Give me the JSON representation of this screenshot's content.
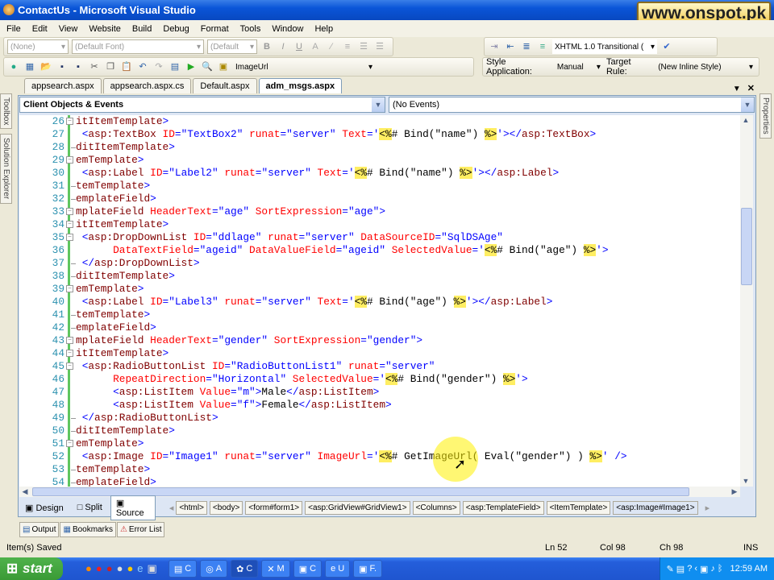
{
  "window": {
    "title": "ContactUs - Microsoft Visual Studio",
    "watermark": "www.onspot.pk"
  },
  "menu": [
    "File",
    "Edit",
    "View",
    "Website",
    "Build",
    "Debug",
    "Format",
    "Tools",
    "Window",
    "Help"
  ],
  "toolbar": {
    "block_format": "(None)",
    "font": "(Default Font)",
    "size": "(Default",
    "bold": "B",
    "italic": "I",
    "underline": "U",
    "doctype": "XHTML 1.0 Transitional (",
    "find_value": "ImageUrl",
    "style_application_label": "Style Application:",
    "style_application_value": "Manual",
    "target_rule_label": "Target Rule:",
    "target_rule_value": "(New Inline Style)"
  },
  "tabs": [
    {
      "label": "appsearch.aspx"
    },
    {
      "label": "appsearch.aspx.cs"
    },
    {
      "label": "Default.aspx"
    },
    {
      "label": "adm_msgs.aspx",
      "active": true
    }
  ],
  "side": {
    "toolbox": "Toolbox",
    "solution_explorer": "Solution Explorer",
    "properties": "Properties"
  },
  "dropdowns": {
    "objects": "Client Objects & Events",
    "events": "(No Events)"
  },
  "code": {
    "lines": [
      {
        "n": "26",
        "fold": "open",
        "segs": [
          [
            "t",
            "itItemTemplate"
          ],
          [
            "b",
            ">"
          ]
        ]
      },
      {
        "n": "27",
        "fold": "",
        "segs": [
          [
            "x",
            " "
          ],
          [
            "b",
            "<"
          ],
          [
            "t",
            "asp:TextBox"
          ],
          [
            "a",
            " ID"
          ],
          [
            "b",
            "="
          ],
          [
            "v",
            "\"TextBox2\""
          ],
          [
            "a",
            " runat"
          ],
          [
            "b",
            "="
          ],
          [
            "v",
            "\"server\""
          ],
          [
            "a",
            " Text"
          ],
          [
            "b",
            "="
          ],
          [
            "v",
            "'"
          ],
          [
            "h",
            "<%"
          ],
          [
            "x",
            "# Bind(\"name\") "
          ],
          [
            "h",
            "%>"
          ],
          [
            "v",
            "'"
          ],
          [
            "b",
            "></"
          ],
          [
            "t",
            "asp:TextBox"
          ],
          [
            "b",
            ">"
          ]
        ]
      },
      {
        "n": "28",
        "fold": "end",
        "segs": [
          [
            "t",
            "ditItemTemplate"
          ],
          [
            "b",
            ">"
          ]
        ]
      },
      {
        "n": "29",
        "fold": "open",
        "segs": [
          [
            "t",
            "emTemplate"
          ],
          [
            "b",
            ">"
          ]
        ]
      },
      {
        "n": "30",
        "fold": "",
        "segs": [
          [
            "x",
            " "
          ],
          [
            "b",
            "<"
          ],
          [
            "t",
            "asp:Label"
          ],
          [
            "a",
            " ID"
          ],
          [
            "b",
            "="
          ],
          [
            "v",
            "\"Label2\""
          ],
          [
            "a",
            " runat"
          ],
          [
            "b",
            "="
          ],
          [
            "v",
            "\"server\""
          ],
          [
            "a",
            " Text"
          ],
          [
            "b",
            "="
          ],
          [
            "v",
            "'"
          ],
          [
            "h",
            "<%"
          ],
          [
            "x",
            "# Bind(\"name\") "
          ],
          [
            "h",
            "%>"
          ],
          [
            "v",
            "'"
          ],
          [
            "b",
            "></"
          ],
          [
            "t",
            "asp:Label"
          ],
          [
            "b",
            ">"
          ]
        ]
      },
      {
        "n": "31",
        "fold": "end",
        "segs": [
          [
            "t",
            "temTemplate"
          ],
          [
            "b",
            ">"
          ]
        ]
      },
      {
        "n": "32",
        "fold": "end",
        "segs": [
          [
            "t",
            "emplateField"
          ],
          [
            "b",
            ">"
          ]
        ]
      },
      {
        "n": "33",
        "fold": "open",
        "segs": [
          [
            "t",
            "mplateField"
          ],
          [
            "a",
            " HeaderText"
          ],
          [
            "b",
            "="
          ],
          [
            "v",
            "\"age\""
          ],
          [
            "a",
            " SortExpression"
          ],
          [
            "b",
            "="
          ],
          [
            "v",
            "\"age\""
          ],
          [
            "b",
            ">"
          ]
        ]
      },
      {
        "n": "34",
        "fold": "open",
        "segs": [
          [
            "t",
            "itItemTemplate"
          ],
          [
            "b",
            ">"
          ]
        ]
      },
      {
        "n": "35",
        "fold": "open",
        "segs": [
          [
            "x",
            " "
          ],
          [
            "b",
            "<"
          ],
          [
            "t",
            "asp:DropDownList"
          ],
          [
            "a",
            " ID"
          ],
          [
            "b",
            "="
          ],
          [
            "v",
            "\"ddlage\""
          ],
          [
            "a",
            " runat"
          ],
          [
            "b",
            "="
          ],
          [
            "v",
            "\"server\""
          ],
          [
            "a",
            " DataSourceID"
          ],
          [
            "b",
            "="
          ],
          [
            "v",
            "\"SqlDSAge\""
          ]
        ]
      },
      {
        "n": "36",
        "fold": "",
        "segs": [
          [
            "x",
            "     "
          ],
          [
            "a",
            " DataTextField"
          ],
          [
            "b",
            "="
          ],
          [
            "v",
            "\"ageid\""
          ],
          [
            "a",
            " DataValueField"
          ],
          [
            "b",
            "="
          ],
          [
            "v",
            "\"ageid\""
          ],
          [
            "a",
            " SelectedValue"
          ],
          [
            "b",
            "="
          ],
          [
            "v",
            "'"
          ],
          [
            "h",
            "<%"
          ],
          [
            "x",
            "# Bind(\"age\") "
          ],
          [
            "h",
            "%>"
          ],
          [
            "v",
            "'"
          ],
          [
            "b",
            ">"
          ]
        ]
      },
      {
        "n": "37",
        "fold": "end",
        "segs": [
          [
            "x",
            " "
          ],
          [
            "b",
            "</"
          ],
          [
            "t",
            "asp:DropDownList"
          ],
          [
            "b",
            ">"
          ]
        ]
      },
      {
        "n": "38",
        "fold": "end",
        "segs": [
          [
            "t",
            "ditItemTemplate"
          ],
          [
            "b",
            ">"
          ]
        ]
      },
      {
        "n": "39",
        "fold": "open",
        "segs": [
          [
            "t",
            "emTemplate"
          ],
          [
            "b",
            ">"
          ]
        ]
      },
      {
        "n": "40",
        "fold": "",
        "segs": [
          [
            "x",
            " "
          ],
          [
            "b",
            "<"
          ],
          [
            "t",
            "asp:Label"
          ],
          [
            "a",
            " ID"
          ],
          [
            "b",
            "="
          ],
          [
            "v",
            "\"Label3\""
          ],
          [
            "a",
            " runat"
          ],
          [
            "b",
            "="
          ],
          [
            "v",
            "\"server\""
          ],
          [
            "a",
            " Text"
          ],
          [
            "b",
            "="
          ],
          [
            "v",
            "'"
          ],
          [
            "h",
            "<%"
          ],
          [
            "x",
            "# Bind(\"age\") "
          ],
          [
            "h",
            "%>"
          ],
          [
            "v",
            "'"
          ],
          [
            "b",
            "></"
          ],
          [
            "t",
            "asp:Label"
          ],
          [
            "b",
            ">"
          ]
        ]
      },
      {
        "n": "41",
        "fold": "end",
        "segs": [
          [
            "t",
            "temTemplate"
          ],
          [
            "b",
            ">"
          ]
        ]
      },
      {
        "n": "42",
        "fold": "end",
        "segs": [
          [
            "t",
            "emplateField"
          ],
          [
            "b",
            ">"
          ]
        ]
      },
      {
        "n": "43",
        "fold": "open",
        "segs": [
          [
            "t",
            "mplateField"
          ],
          [
            "a",
            " HeaderText"
          ],
          [
            "b",
            "="
          ],
          [
            "v",
            "\"gender\""
          ],
          [
            "a",
            " SortExpression"
          ],
          [
            "b",
            "="
          ],
          [
            "v",
            "\"gender\""
          ],
          [
            "b",
            ">"
          ]
        ]
      },
      {
        "n": "44",
        "fold": "open",
        "segs": [
          [
            "t",
            "itItemTemplate"
          ],
          [
            "b",
            ">"
          ]
        ]
      },
      {
        "n": "45",
        "fold": "open",
        "segs": [
          [
            "x",
            " "
          ],
          [
            "b",
            "<"
          ],
          [
            "t",
            "asp:RadioButtonList"
          ],
          [
            "a",
            " ID"
          ],
          [
            "b",
            "="
          ],
          [
            "v",
            "\"RadioButtonList1\""
          ],
          [
            "a",
            " runat"
          ],
          [
            "b",
            "="
          ],
          [
            "v",
            "\"server\""
          ]
        ]
      },
      {
        "n": "46",
        "fold": "",
        "segs": [
          [
            "x",
            "     "
          ],
          [
            "a",
            " RepeatDirection"
          ],
          [
            "b",
            "="
          ],
          [
            "v",
            "\"Horizontal\""
          ],
          [
            "a",
            " SelectedValue"
          ],
          [
            "b",
            "="
          ],
          [
            "v",
            "'"
          ],
          [
            "h",
            "<%"
          ],
          [
            "x",
            "# Bind(\"gender\") "
          ],
          [
            "h",
            "%>"
          ],
          [
            "v",
            "'"
          ],
          [
            "b",
            ">"
          ]
        ]
      },
      {
        "n": "47",
        "fold": "",
        "segs": [
          [
            "x",
            "     "
          ],
          [
            "b",
            " <"
          ],
          [
            "t",
            "asp:ListItem"
          ],
          [
            "a",
            " Value"
          ],
          [
            "b",
            "="
          ],
          [
            "v",
            "\"m\""
          ],
          [
            "b",
            ">"
          ],
          [
            "x",
            "Male"
          ],
          [
            "b",
            "</"
          ],
          [
            "t",
            "asp:ListItem"
          ],
          [
            "b",
            ">"
          ]
        ]
      },
      {
        "n": "48",
        "fold": "",
        "segs": [
          [
            "x",
            "     "
          ],
          [
            "b",
            " <"
          ],
          [
            "t",
            "asp:ListItem"
          ],
          [
            "a",
            " Value"
          ],
          [
            "b",
            "="
          ],
          [
            "v",
            "\"f\""
          ],
          [
            "b",
            ">"
          ],
          [
            "x",
            "Female"
          ],
          [
            "b",
            "</"
          ],
          [
            "t",
            "asp:ListItem"
          ],
          [
            "b",
            ">"
          ]
        ]
      },
      {
        "n": "49",
        "fold": "end",
        "segs": [
          [
            "x",
            " "
          ],
          [
            "b",
            "</"
          ],
          [
            "t",
            "asp:RadioButtonList"
          ],
          [
            "b",
            ">"
          ]
        ]
      },
      {
        "n": "50",
        "fold": "end",
        "segs": [
          [
            "t",
            "ditItemTemplate"
          ],
          [
            "b",
            ">"
          ]
        ]
      },
      {
        "n": "51",
        "fold": "open",
        "segs": [
          [
            "t",
            "emTemplate"
          ],
          [
            "b",
            ">"
          ]
        ]
      },
      {
        "n": "52",
        "fold": "",
        "segs": [
          [
            "x",
            " "
          ],
          [
            "b",
            "<"
          ],
          [
            "t",
            "asp:Image"
          ],
          [
            "a",
            " ID"
          ],
          [
            "b",
            "="
          ],
          [
            "v",
            "\"Image1\""
          ],
          [
            "a",
            " runat"
          ],
          [
            "b",
            "="
          ],
          [
            "v",
            "\"server\""
          ],
          [
            "a",
            " ImageUrl"
          ],
          [
            "b",
            "="
          ],
          [
            "v",
            "'"
          ],
          [
            "h",
            "<%"
          ],
          [
            "x",
            "# GetImageUrl( Eval(\"gender\") ) "
          ],
          [
            "h",
            "%>"
          ],
          [
            "v",
            "'"
          ],
          [
            "b",
            " />"
          ]
        ]
      },
      {
        "n": "53",
        "fold": "end",
        "segs": [
          [
            "t",
            "temTemplate"
          ],
          [
            "b",
            ">"
          ]
        ]
      },
      {
        "n": "54",
        "fold": "end",
        "segs": [
          [
            "t",
            "emplateField"
          ],
          [
            "b",
            ">"
          ]
        ]
      }
    ]
  },
  "views": {
    "design": "Design",
    "split": "Split",
    "source": "Source"
  },
  "breadcrumb": [
    "<html>",
    "<body>",
    "<form#form1>",
    "<asp:GridView#GridView1>",
    "<Columns>",
    "<asp:TemplateField>",
    "<ItemTemplate>",
    "<asp:Image#Image1>"
  ],
  "panels": {
    "output": "Output",
    "bookmarks": "Bookmarks",
    "error_list": "Error List"
  },
  "status": {
    "message": "Item(s) Saved",
    "ln": "Ln 52",
    "col": "Col 98",
    "ch": "Ch 98",
    "mode": "INS"
  },
  "taskbar": {
    "start": "start",
    "items": [
      "C",
      "A",
      "C",
      "M",
      "C",
      "U",
      "F."
    ],
    "clock": "12:59 AM"
  }
}
